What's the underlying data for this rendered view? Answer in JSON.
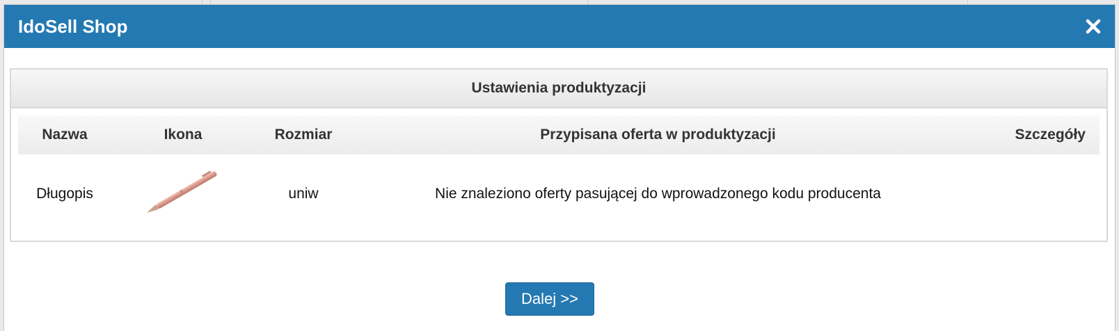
{
  "modal": {
    "title": "IdoSell Shop",
    "close_icon": "close-icon"
  },
  "panel": {
    "heading": "Ustawienia produktyzacji",
    "columns": [
      "Nazwa",
      "Ikona",
      "Rozmiar",
      "Przypisana oferta w produktyzacji",
      "Szczegóły"
    ],
    "rows": [
      {
        "name": "Długopis",
        "icon": "pen-product-image",
        "size": "uniw",
        "offer": "Nie znaleziono oferty pasującej do wprowadzonego kodu producenta",
        "details": ""
      }
    ]
  },
  "footer": {
    "next_label": "Dalej >>"
  },
  "colors": {
    "header": "#2479b2",
    "button": "#2479b2"
  }
}
